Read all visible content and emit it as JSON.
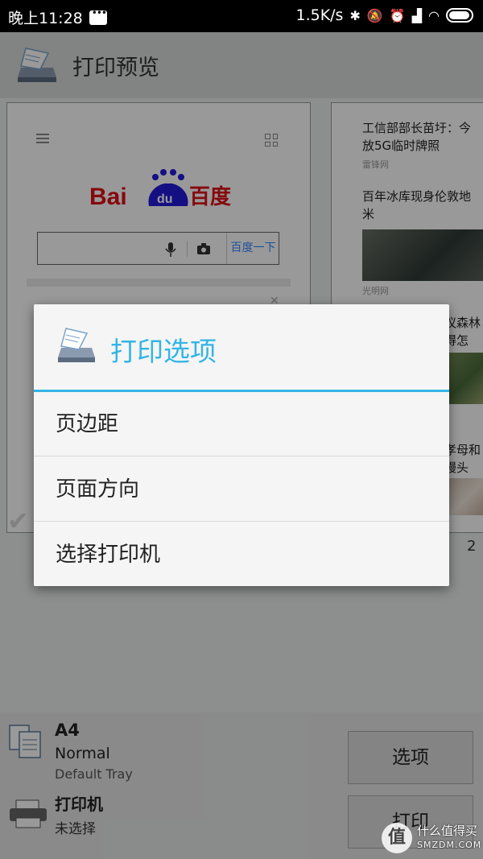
{
  "status_bar": {
    "time": "晚上11:28",
    "net_speed": "1.5K/s"
  },
  "app_bar": {
    "title": "打印预览"
  },
  "preview": {
    "left_page": {
      "search_button_label": "百度一下",
      "logo_text": "Bai du 百度"
    },
    "right_page": {
      "news": [
        {
          "title_line1": "工信部部长苗圩：今",
          "title_line2": "放5G临时牌照",
          "source": "雷锋网"
        },
        {
          "title_line1": "百年冰库现身伦敦地",
          "title_line2": "米",
          "source": "光明网"
        },
        {
          "title_line1": "议森林",
          "title_line2": "得怎"
        },
        {
          "title_line1": "孝母和",
          "title_line2": "馒头"
        }
      ],
      "page_number": "2"
    }
  },
  "dialog": {
    "title": "打印选项",
    "items": [
      {
        "label": "页边距"
      },
      {
        "label": "页面方向"
      },
      {
        "label": "选择打印机"
      }
    ]
  },
  "bottom": {
    "paper_size": "A4",
    "paper_type": "Normal",
    "paper_tray": "Default Tray",
    "printer_label": "打印机",
    "printer_status": "未选择",
    "options_button": "选项",
    "print_button": "打印"
  },
  "watermark": {
    "glyph": "值",
    "line1": "什么值得买",
    "line2": "SMZDM.COM"
  },
  "colors": {
    "accent": "#33b5e5",
    "baidu_red": "#de0f17",
    "baidu_blue": "#2319dc"
  }
}
